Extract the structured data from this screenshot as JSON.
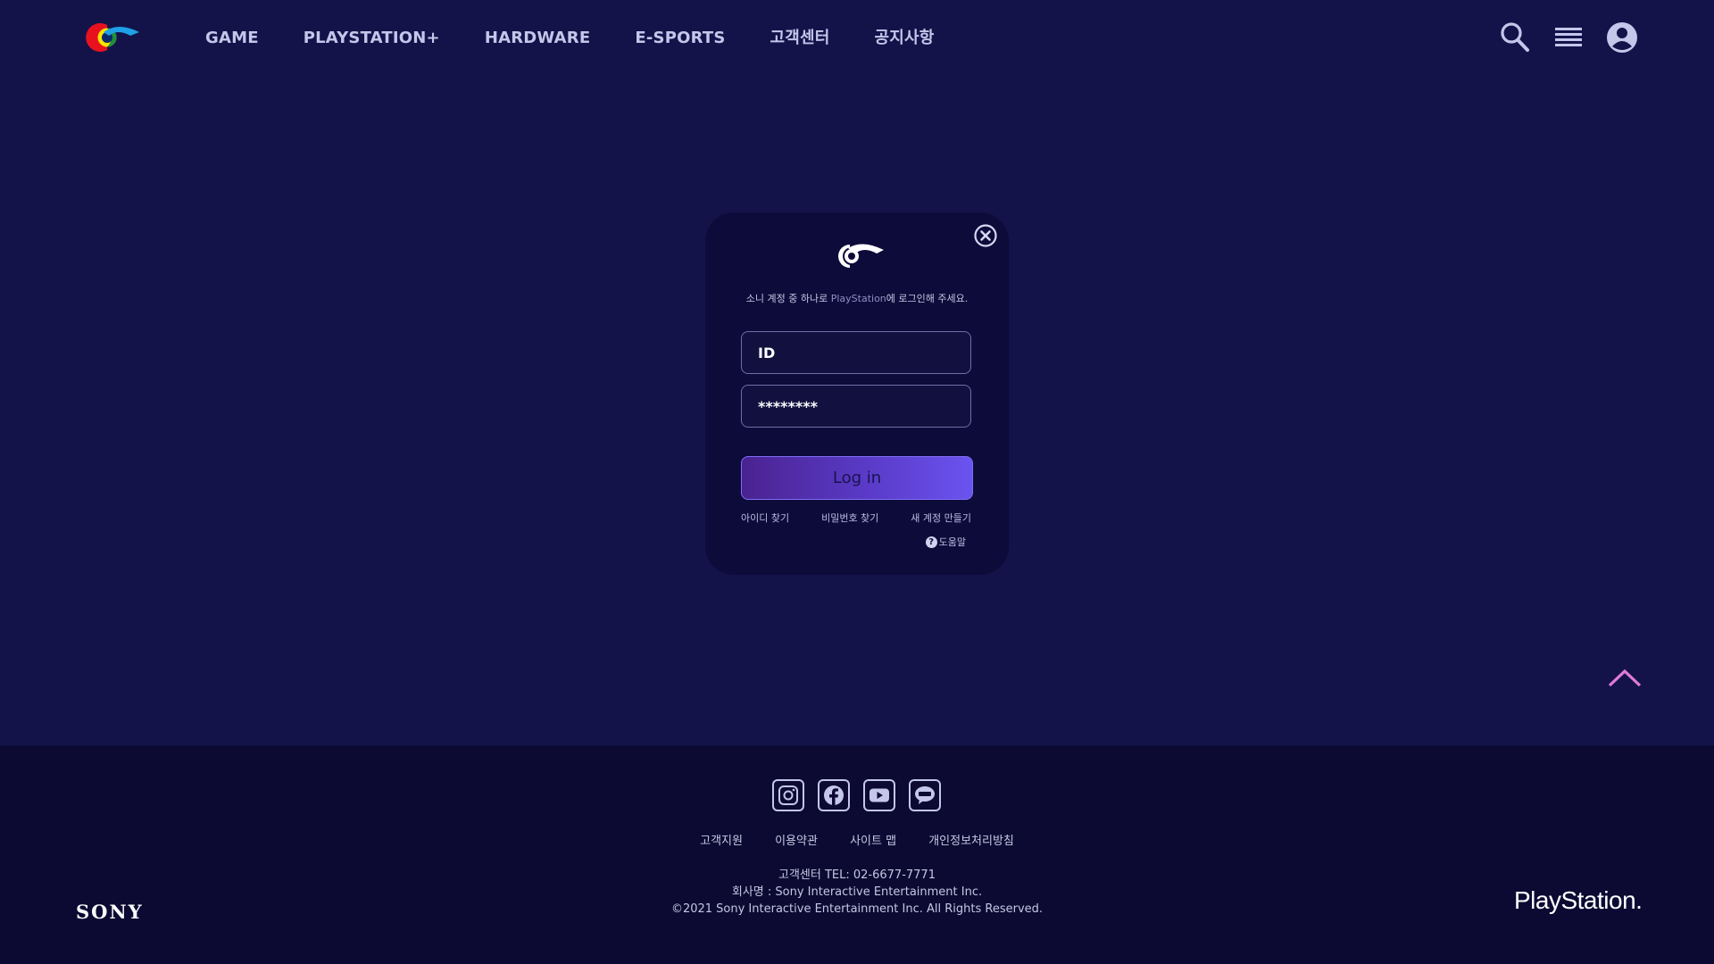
{
  "nav": {
    "items": [
      "GAME",
      "PLAYSTATION+",
      "HARDWARE",
      "E-SPORTS",
      "고객센터",
      "공지사항"
    ]
  },
  "header_icons": [
    "search-icon",
    "menu-icon",
    "account-icon"
  ],
  "login": {
    "subtitle_pre": "소니 계정 중 하나로 ",
    "subtitle_brand": "PlayStation",
    "subtitle_post": "에 로그인해 주세요.",
    "id_placeholder": "ID",
    "password_value": "********",
    "button_label": "Log in",
    "links": [
      "아이디 찾기",
      "비밀번호 찾기",
      "새 계정 만들기"
    ],
    "help": "도움말"
  },
  "footer": {
    "social_icons": [
      "instagram-icon",
      "facebook-icon",
      "youtube-icon",
      "kakaotalk-icon"
    ],
    "links": [
      "고객지원",
      "이용약관",
      "사이트 맵",
      "개인정보처리방침"
    ],
    "tel": "고객센터 TEL: 02-6677-7771",
    "company": "회사명 : Sony Interactive Entertainment Inc.",
    "copyright": "©2021 Sony Interactive Entertainment Inc. All Rights Reserved.",
    "sony_logo": "SONY",
    "playstation_logo": "PlayStation."
  },
  "colors": {
    "background": "#13134a",
    "footer_bg": "#0c0a33",
    "modal_bg": "#0d0b3a",
    "scroll_top_arrow": "#e07ad8",
    "button_gradient_start": "#4a2290",
    "button_gradient_end": "#6a53ef"
  }
}
